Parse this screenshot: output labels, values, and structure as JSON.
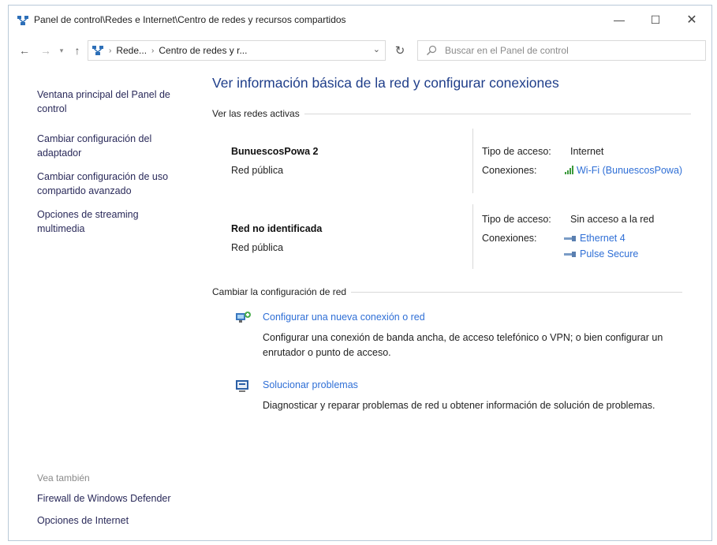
{
  "window": {
    "title": "Panel de control\\Redes e Internet\\Centro de redes y recursos compartidos",
    "controls": {
      "minimize": "—",
      "maximize": "☐",
      "close": "✕"
    }
  },
  "nav": {
    "back": "←",
    "forward": "→",
    "recent": "▾",
    "up": "↑",
    "breadcrumb": [
      "Rede...",
      "Centro de redes y r..."
    ],
    "breadcrumb_sep_first": "›",
    "breadcrumb_sep": "›",
    "address_dropdown": "⌄",
    "refresh": "↻",
    "search_placeholder": "Buscar en el Panel de control"
  },
  "sidebar": {
    "items": [
      {
        "label": "Ventana principal del Panel de control"
      },
      {
        "label": "Cambiar configuración del adaptador"
      },
      {
        "label": "Cambiar configuración de uso compartido avanzado"
      },
      {
        "label": "Opciones de streaming multimedia"
      }
    ],
    "see_also_heading": "Vea también",
    "see_also": [
      {
        "label": "Firewall de Windows Defender"
      },
      {
        "label": "Opciones de Internet"
      }
    ]
  },
  "main": {
    "title": "Ver información básica de la red y configurar conexiones",
    "active_networks_heading": "Ver las redes activas",
    "networks": [
      {
        "name": "BunuescosPowa 2",
        "type": "Red pública",
        "access_label": "Tipo de acceso:",
        "access_value": "Internet",
        "connections_label": "Conexiones:",
        "connections": [
          "Wi-Fi (BunuescosPowa)"
        ]
      },
      {
        "name": "Red no identificada",
        "type": "Red pública",
        "access_label": "Tipo de acceso:",
        "access_value": "Sin acceso a la red",
        "connections_label": "Conexiones:",
        "connections": [
          "Ethernet 4",
          "Pulse Secure"
        ]
      }
    ],
    "change_heading": "Cambiar la configuración de red",
    "tasks": [
      {
        "link": "Configurar una nueva conexión o red",
        "description": "Configurar una conexión de banda ancha, de acceso telefónico o VPN; o bien configurar un enrutador o punto de acceso."
      },
      {
        "link": "Solucionar problemas",
        "description": "Diagnosticar y reparar problemas de red u obtener información de solución de problemas."
      }
    ]
  },
  "colors": {
    "link": "#2f6fd6",
    "title": "#1f3e8a",
    "sidebar_link": "#2a2a5a"
  }
}
